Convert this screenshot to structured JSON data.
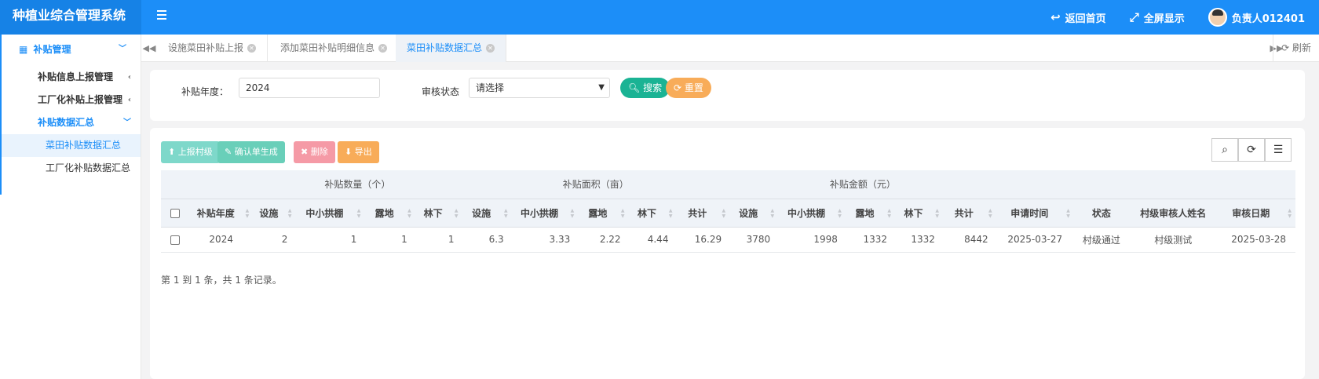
{
  "header": {
    "brand": "种植业综合管理系统",
    "back_home": "返回首页",
    "fullscreen": "全屏显示",
    "user": "负责人012401",
    "accent_color": "#1c8ef8"
  },
  "sidebar": {
    "group": "补贴管理",
    "items": [
      {
        "label": "补贴信息上报管理"
      },
      {
        "label": "工厂化补贴上报管理"
      },
      {
        "label": "补贴数据汇总"
      }
    ],
    "subitems": [
      {
        "label": "菜田补贴数据汇总"
      },
      {
        "label": "工厂化补贴数据汇总"
      }
    ]
  },
  "tabs": [
    {
      "label": "设施菜田补贴上报"
    },
    {
      "label": "添加菜田补贴明细信息"
    },
    {
      "label": "菜田补贴数据汇总"
    }
  ],
  "refresh_label": "刷新",
  "search": {
    "year_label": "补贴年度：",
    "year_value": "2024",
    "status_label": "审核状态",
    "status_value": "请选择",
    "search_btn": "搜索",
    "reset_btn": "重置"
  },
  "toolbar": {
    "report": "上报村级",
    "confirm": "确认单生成",
    "delete": "删除",
    "export": "导出"
  },
  "table": {
    "groups": [
      "补贴数量（个）",
      "补贴面积（亩）",
      "补贴金额（元）"
    ],
    "columns": [
      "补贴年度",
      "设施",
      "中小拱棚",
      "露地",
      "林下",
      "设施",
      "中小拱棚",
      "露地",
      "林下",
      "共计",
      "设施",
      "中小拱棚",
      "露地",
      "林下",
      "共计",
      "申请时间",
      "状态",
      "村级审核人姓名",
      "审核日期"
    ],
    "rows": [
      [
        "2024",
        "2",
        "1",
        "1",
        "1",
        "6.3",
        "3.33",
        "2.22",
        "4.44",
        "16.29",
        "3780",
        "1998",
        "1332",
        "1332",
        "8442",
        "2025-03-27",
        "村级通过",
        "村级测试",
        "2025-03-28"
      ]
    ]
  },
  "pagination": "第 1 到 1 条，共 1 条记录。"
}
